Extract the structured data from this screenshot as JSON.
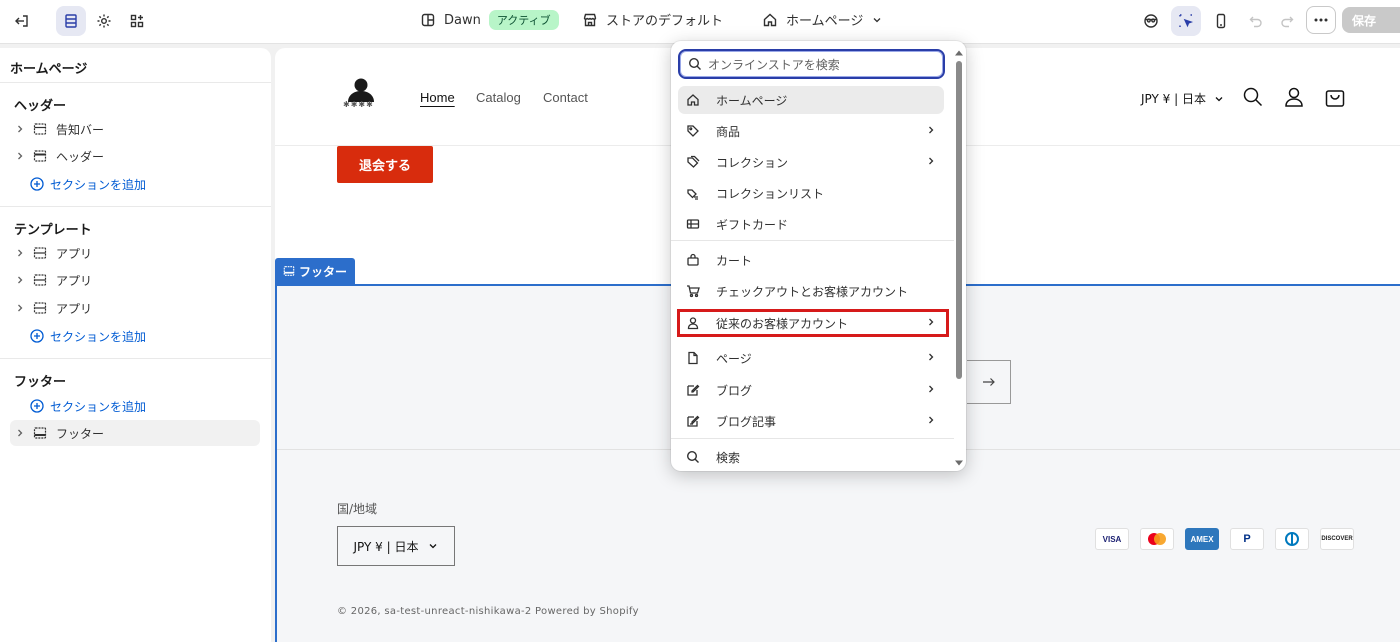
{
  "topbar": {
    "theme_name": "Dawn",
    "theme_status": "アクティブ",
    "store_default": "ストアのデフォルト",
    "page_selector": "ホームページ",
    "save_label": "保存"
  },
  "sidebar": {
    "title": "ホームページ",
    "header_group": {
      "heading": "ヘッダー",
      "items": [
        {
          "label": "告知バー"
        },
        {
          "label": "ヘッダー"
        }
      ],
      "add_label": "セクションを追加"
    },
    "template_group": {
      "heading": "テンプレート",
      "items": [
        {
          "label": "アプリ"
        },
        {
          "label": "アプリ"
        },
        {
          "label": "アプリ"
        }
      ],
      "add_label": "セクションを追加"
    },
    "footer_group": {
      "heading": "フッター",
      "add_label": "セクションを追加",
      "items": [
        {
          "label": "フッター"
        }
      ]
    }
  },
  "preview": {
    "logo_text": "✱✱✱✱",
    "nav": [
      "Home",
      "Catalog",
      "Contact"
    ],
    "currency": "JPY ¥ | 日本",
    "cancel_button": "退会する",
    "footer_tag": "フッター",
    "region_label": "国/地域",
    "region_value": "JPY ¥ | 日本",
    "payments": [
      "VISA",
      "MC",
      "AMEX",
      "PayPal",
      "Diners",
      "DISCOVER"
    ],
    "copyright": "© 2026, sa-test-unreact-nishikawa-2 Powered by Shopify"
  },
  "dropdown": {
    "search_placeholder": "オンラインストアを検索",
    "items": [
      {
        "label": "ホームページ",
        "icon": "home-icon",
        "arrow": false
      },
      {
        "label": "商品",
        "icon": "tag-icon",
        "arrow": true
      },
      {
        "label": "コレクション",
        "icon": "collection-icon",
        "arrow": true
      },
      {
        "label": "コレクションリスト",
        "icon": "collection-list-icon",
        "arrow": false
      },
      {
        "label": "ギフトカード",
        "icon": "gift-card-icon",
        "arrow": false
      },
      {
        "label": "カート",
        "icon": "bag-icon",
        "arrow": false
      },
      {
        "label": "チェックアウトとお客様アカウント",
        "icon": "cart-icon",
        "arrow": false
      },
      {
        "label": "従来のお客様アカウント",
        "icon": "person-icon",
        "arrow": true
      },
      {
        "label": "ページ",
        "icon": "page-icon",
        "arrow": true
      },
      {
        "label": "ブログ",
        "icon": "blog-icon",
        "arrow": true
      },
      {
        "label": "ブログ記事",
        "icon": "blog-post-icon",
        "arrow": true
      },
      {
        "label": "検索",
        "icon": "search-icon",
        "arrow": false
      }
    ]
  },
  "colors": {
    "accent": "#005bd3",
    "highlight": "#d61a1a",
    "cancel": "#d82c0d",
    "badge": "#b8f5c8"
  }
}
